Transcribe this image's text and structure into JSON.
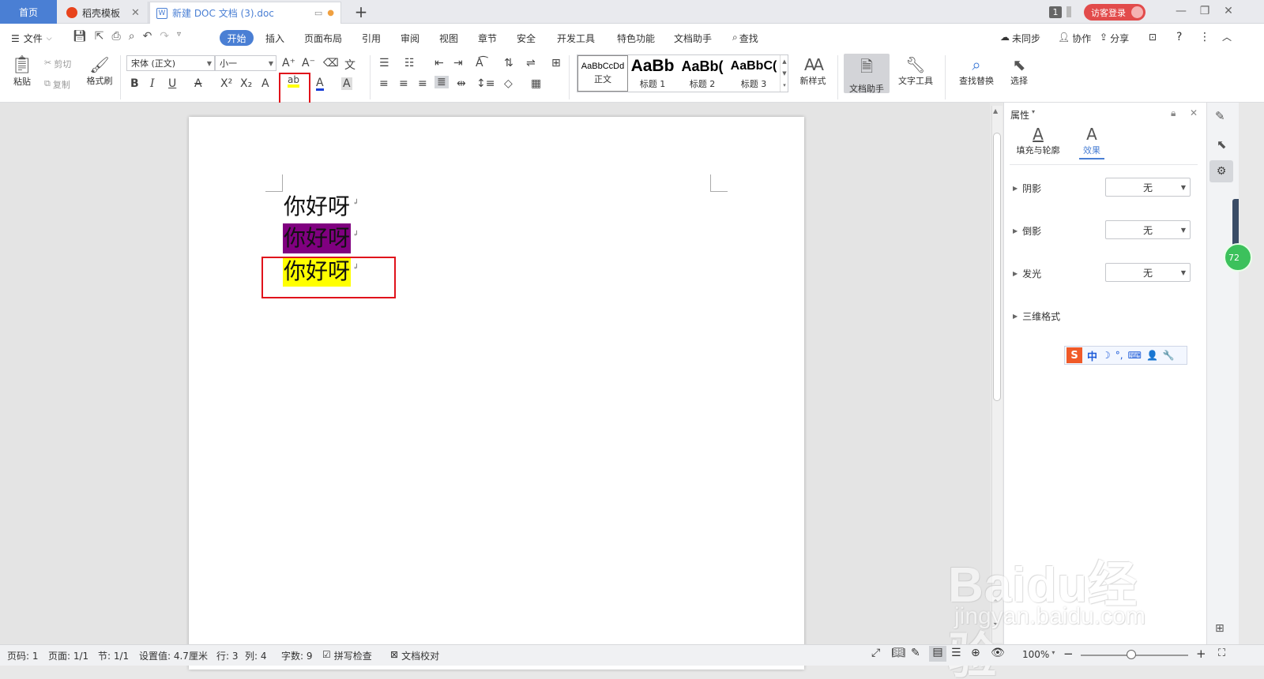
{
  "titlebar": {
    "home_tab": "首页",
    "tabs": [
      {
        "label": "稻壳模板",
        "icon": "daoke-icon"
      },
      {
        "label": "新建 DOC 文档 (3).doc",
        "icon": "word-doc-icon"
      }
    ],
    "window_count": "1",
    "login_label": "访客登录"
  },
  "menubar": {
    "file": "文件",
    "items": [
      "开始",
      "插入",
      "页面布局",
      "引用",
      "审阅",
      "视图",
      "章节",
      "安全",
      "开发工具",
      "特色功能",
      "文档助手"
    ],
    "search": "查找",
    "right": [
      "未同步",
      "协作",
      "分享"
    ]
  },
  "ribbon": {
    "paste": "粘贴",
    "cut": "剪切",
    "copy": "复制",
    "format_painter": "格式刷",
    "font_name": "宋体 (正文)",
    "font_size": "小一",
    "styles": [
      {
        "preview": "AaBbCcDd",
        "label": "正文"
      },
      {
        "preview": "AaBb",
        "label": "标题 1"
      },
      {
        "preview": "AaBb(",
        "label": "标题 2"
      },
      {
        "preview": "AaBbC(",
        "label": "标题 3"
      }
    ],
    "new_style": "新样式",
    "doc_assistant": "文档助手",
    "text_tools": "文字工具",
    "find_replace": "查找替换",
    "select": "选择"
  },
  "document": {
    "lines": [
      {
        "text": "你好呀",
        "highlight": "none"
      },
      {
        "text": "你好呀",
        "highlight": "#800080"
      },
      {
        "text": "你好呀",
        "highlight": "#ffff00"
      }
    ],
    "paragraph_mark": "↲"
  },
  "properties": {
    "title": "属性",
    "tabs": [
      "填充与轮廓",
      "效果"
    ],
    "active_tab": "效果",
    "rows": [
      {
        "label": "阴影",
        "value": "无"
      },
      {
        "label": "倒影",
        "value": "无"
      },
      {
        "label": "发光",
        "value": "无"
      },
      {
        "label": "三维格式",
        "value": ""
      }
    ],
    "ime": [
      "中",
      "☽",
      "°,",
      "⌨",
      "👤",
      "🔧"
    ]
  },
  "floating_ball": "72",
  "statusbar": {
    "page": "页码: 1",
    "pages": "页面: 1/1",
    "section": "节: 1/1",
    "setting": "设置值: 4.7厘米",
    "row": "行: 3",
    "col": "列: 4",
    "words": "字数: 9",
    "spell": "拼写检查",
    "proof": "文档校对",
    "zoom": "100%",
    "zoom_percent": 100
  },
  "watermark": {
    "big": "Baidu经验",
    "small": "jingyan.baidu.com"
  },
  "colors": {
    "accent": "#4a7fd4",
    "login": "#e24b4b",
    "annotation": "#e0121b",
    "highlight_purple": "#800080",
    "highlight_yellow": "#ffff00"
  }
}
